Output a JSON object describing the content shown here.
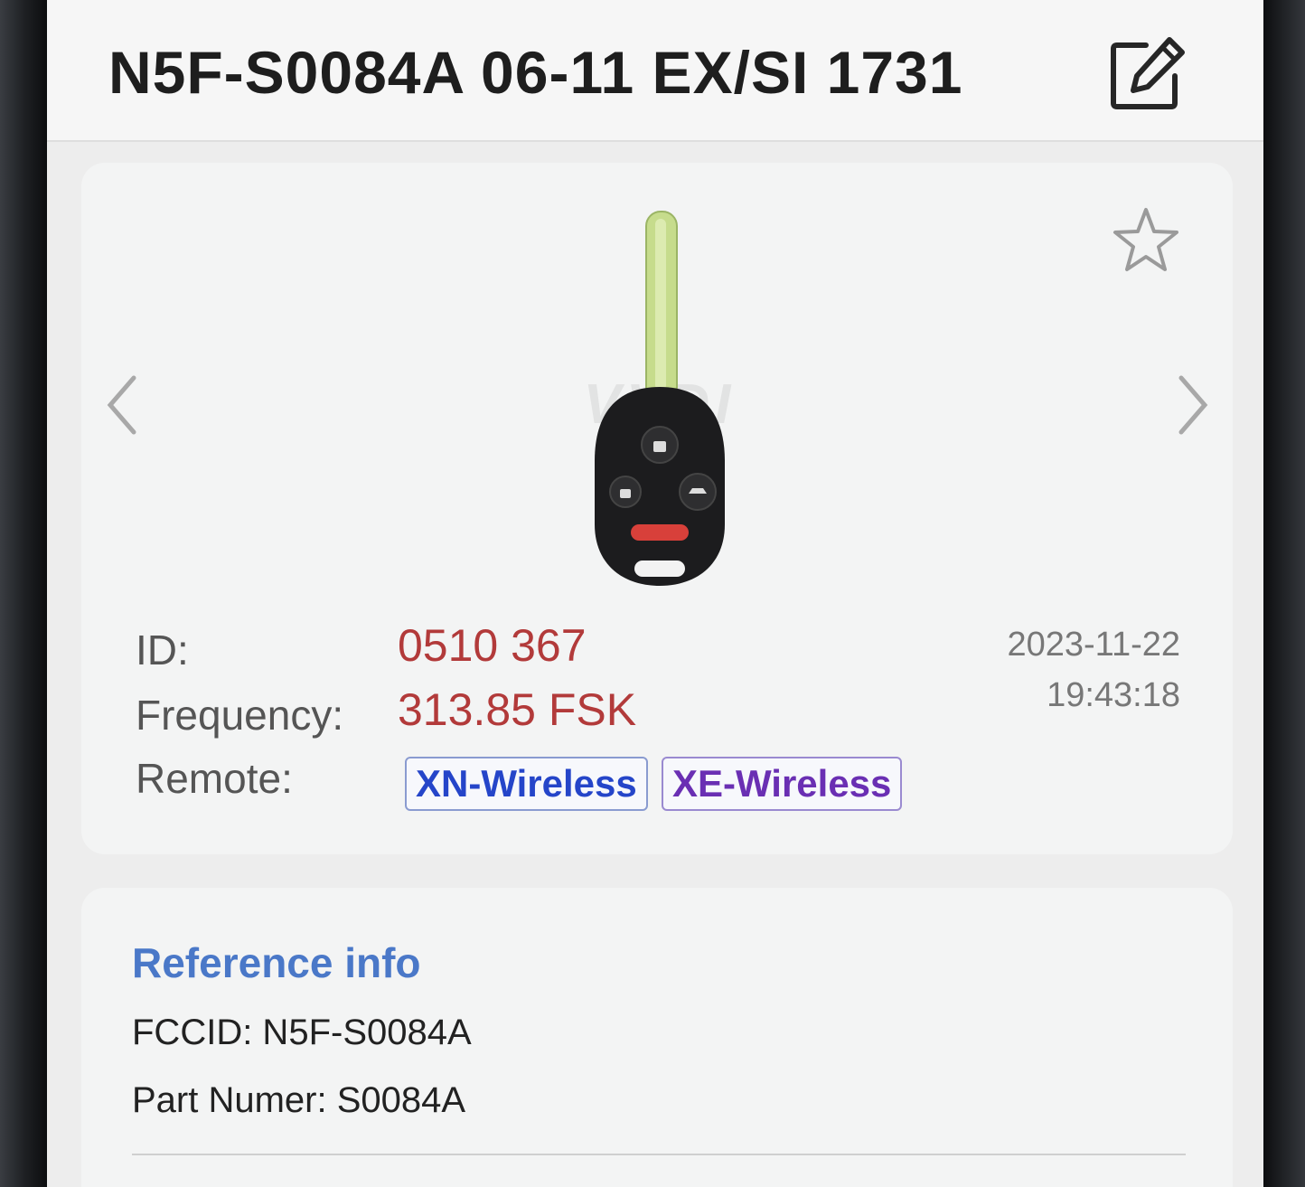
{
  "header": {
    "title": "N5F-S0084A 06-11 EX/SI 1731",
    "edit_icon": "edit-icon"
  },
  "detail": {
    "watermark": "VVDI",
    "id_label": "ID:",
    "id_value": "0510 367",
    "frequency_label": "Frequency:",
    "frequency_value": "313.85 FSK",
    "remote_label": "Remote:",
    "remote_tags": [
      "XN-Wireless",
      "XE-Wireless"
    ],
    "date": "2023-11-22",
    "time": "19:43:18",
    "favorite_icon": "star-icon",
    "prev_icon": "chevron-left-icon",
    "next_icon": "chevron-right-icon",
    "value_color": "#b23a3a"
  },
  "reference": {
    "title": "Reference info",
    "fccid": "FCCID: N5F-S0084A",
    "part_number": "Part Numer: S0084A"
  }
}
